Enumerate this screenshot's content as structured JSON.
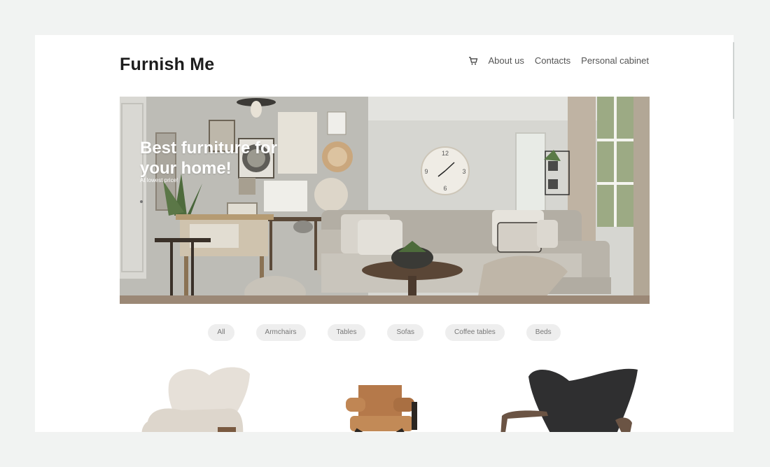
{
  "header": {
    "logo": "Furnish Me",
    "nav": [
      {
        "label": "About us"
      },
      {
        "label": "Contacts"
      },
      {
        "label": "Personal cabinet"
      }
    ],
    "cart_icon": "cart-icon"
  },
  "hero": {
    "title": "Best furniture for your home!",
    "subtitle": "At lowest price!",
    "clock_numbers": [
      "12",
      "3",
      "6",
      "9"
    ]
  },
  "filters": [
    {
      "label": "All"
    },
    {
      "label": "Armchairs"
    },
    {
      "label": "Tables"
    },
    {
      "label": "Sofas"
    },
    {
      "label": "Coffee tables"
    },
    {
      "label": "Beds"
    }
  ],
  "colors": {
    "background": "#f1f3f2",
    "page": "#ffffff",
    "chip": "#eeeeee",
    "text": "#222222"
  }
}
